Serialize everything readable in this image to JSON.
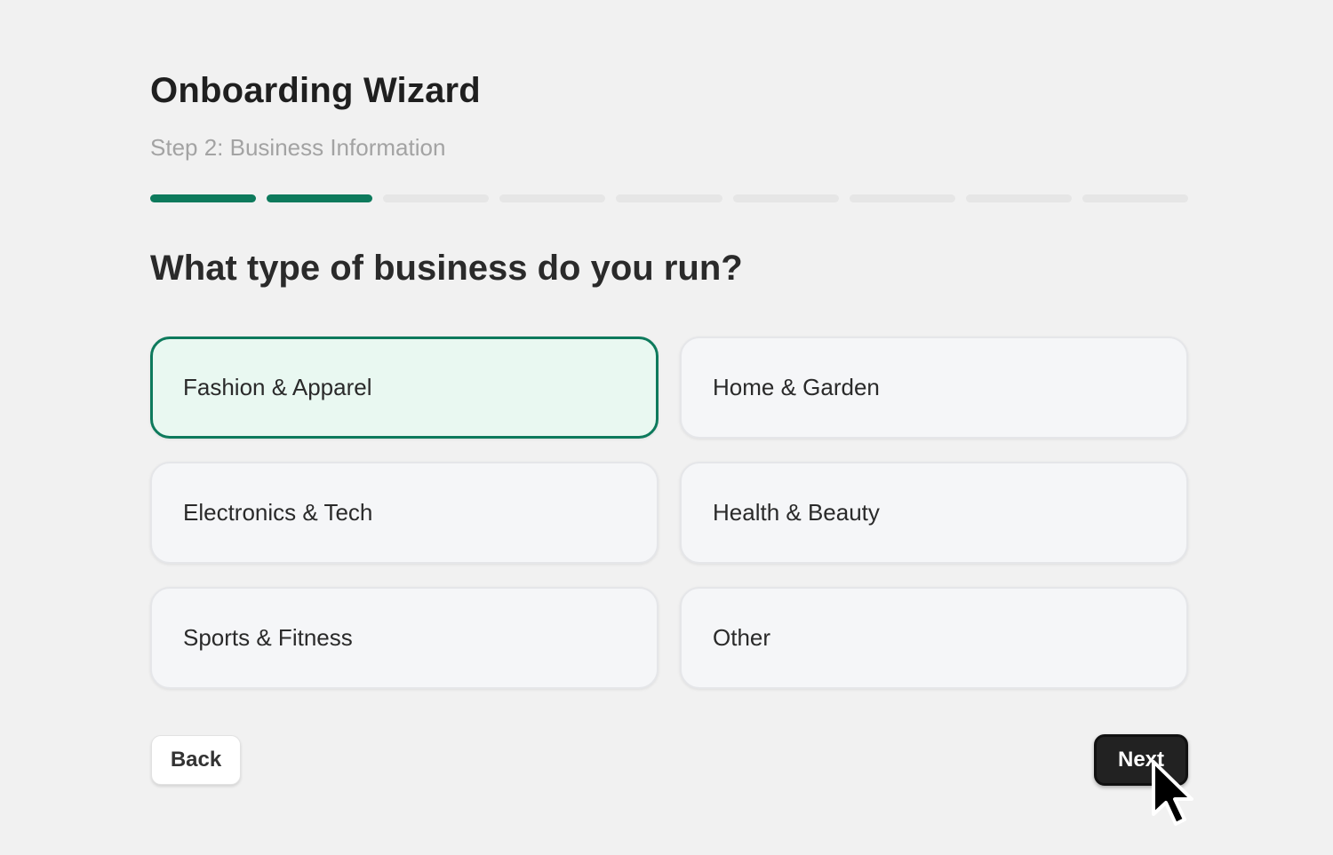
{
  "wizard": {
    "title": "Onboarding Wizard",
    "subtitle": "Step 2: Business Information",
    "progress": {
      "current_step": 2,
      "total_steps": 9
    },
    "question": "What type of business do you run?",
    "options": [
      {
        "label": "Fashion & Apparel",
        "selected": true
      },
      {
        "label": "Home & Garden",
        "selected": false
      },
      {
        "label": "Electronics & Tech",
        "selected": false
      },
      {
        "label": "Health & Beauty",
        "selected": false
      },
      {
        "label": "Sports & Fitness",
        "selected": false
      },
      {
        "label": "Other",
        "selected": false
      }
    ],
    "back_label": "Back",
    "next_label": "Next"
  },
  "colors": {
    "accent": "#0d7a5c",
    "selected_background": "#e9f8f1",
    "page_background": "#f1f1f1",
    "next_button": "#222222"
  },
  "icons": {
    "cursor": "mouse-pointer-icon"
  }
}
